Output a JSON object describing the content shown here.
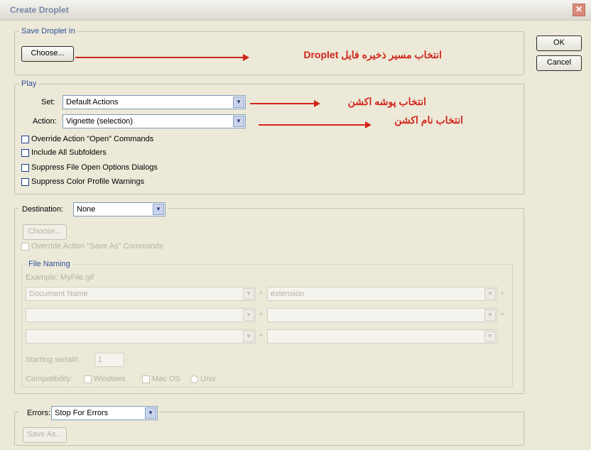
{
  "window": {
    "title": "Create Droplet",
    "close_glyph": "✕"
  },
  "buttons": {
    "ok": "OK",
    "cancel": "Cancel"
  },
  "save_in": {
    "legend": "Save Droplet In",
    "choose": "Choose...",
    "annotation": "انتخاب مسیر ذخیره فایل Droplet"
  },
  "play": {
    "legend": "Play",
    "set_label": "Set:",
    "set_value": "Default Actions",
    "action_label": "Action:",
    "action_value": "Vignette (selection)",
    "set_annotation": "انتخاب پوشه اکشن",
    "action_annotation": "انتخاب نام اکشن",
    "options": [
      "Override Action \"Open\" Commands",
      "Include All Subfolders",
      "Suppress File Open Options Dialogs",
      "Suppress Color Profile Warnings"
    ]
  },
  "destination": {
    "label": "Destination:",
    "value": "None",
    "choose": "Choose...",
    "override": "Override Action \"Save As\" Commands",
    "file_naming": {
      "legend": "File Naming",
      "example": "Example: MyFile.gif",
      "fields": [
        "Document Name",
        "extension",
        "",
        "",
        "",
        ""
      ],
      "serial_label": "Starting serial#:",
      "serial_value": "1",
      "compat_label": "Compatibility:",
      "compat_options": [
        "Windows",
        "Mac OS",
        "Unix"
      ]
    }
  },
  "errors": {
    "label": "Errors:",
    "value": "Stop For Errors",
    "save_as": "Save As..."
  },
  "colors": {
    "annotation_red": "#d2261b",
    "legend_blue": "#2f4f9a"
  }
}
